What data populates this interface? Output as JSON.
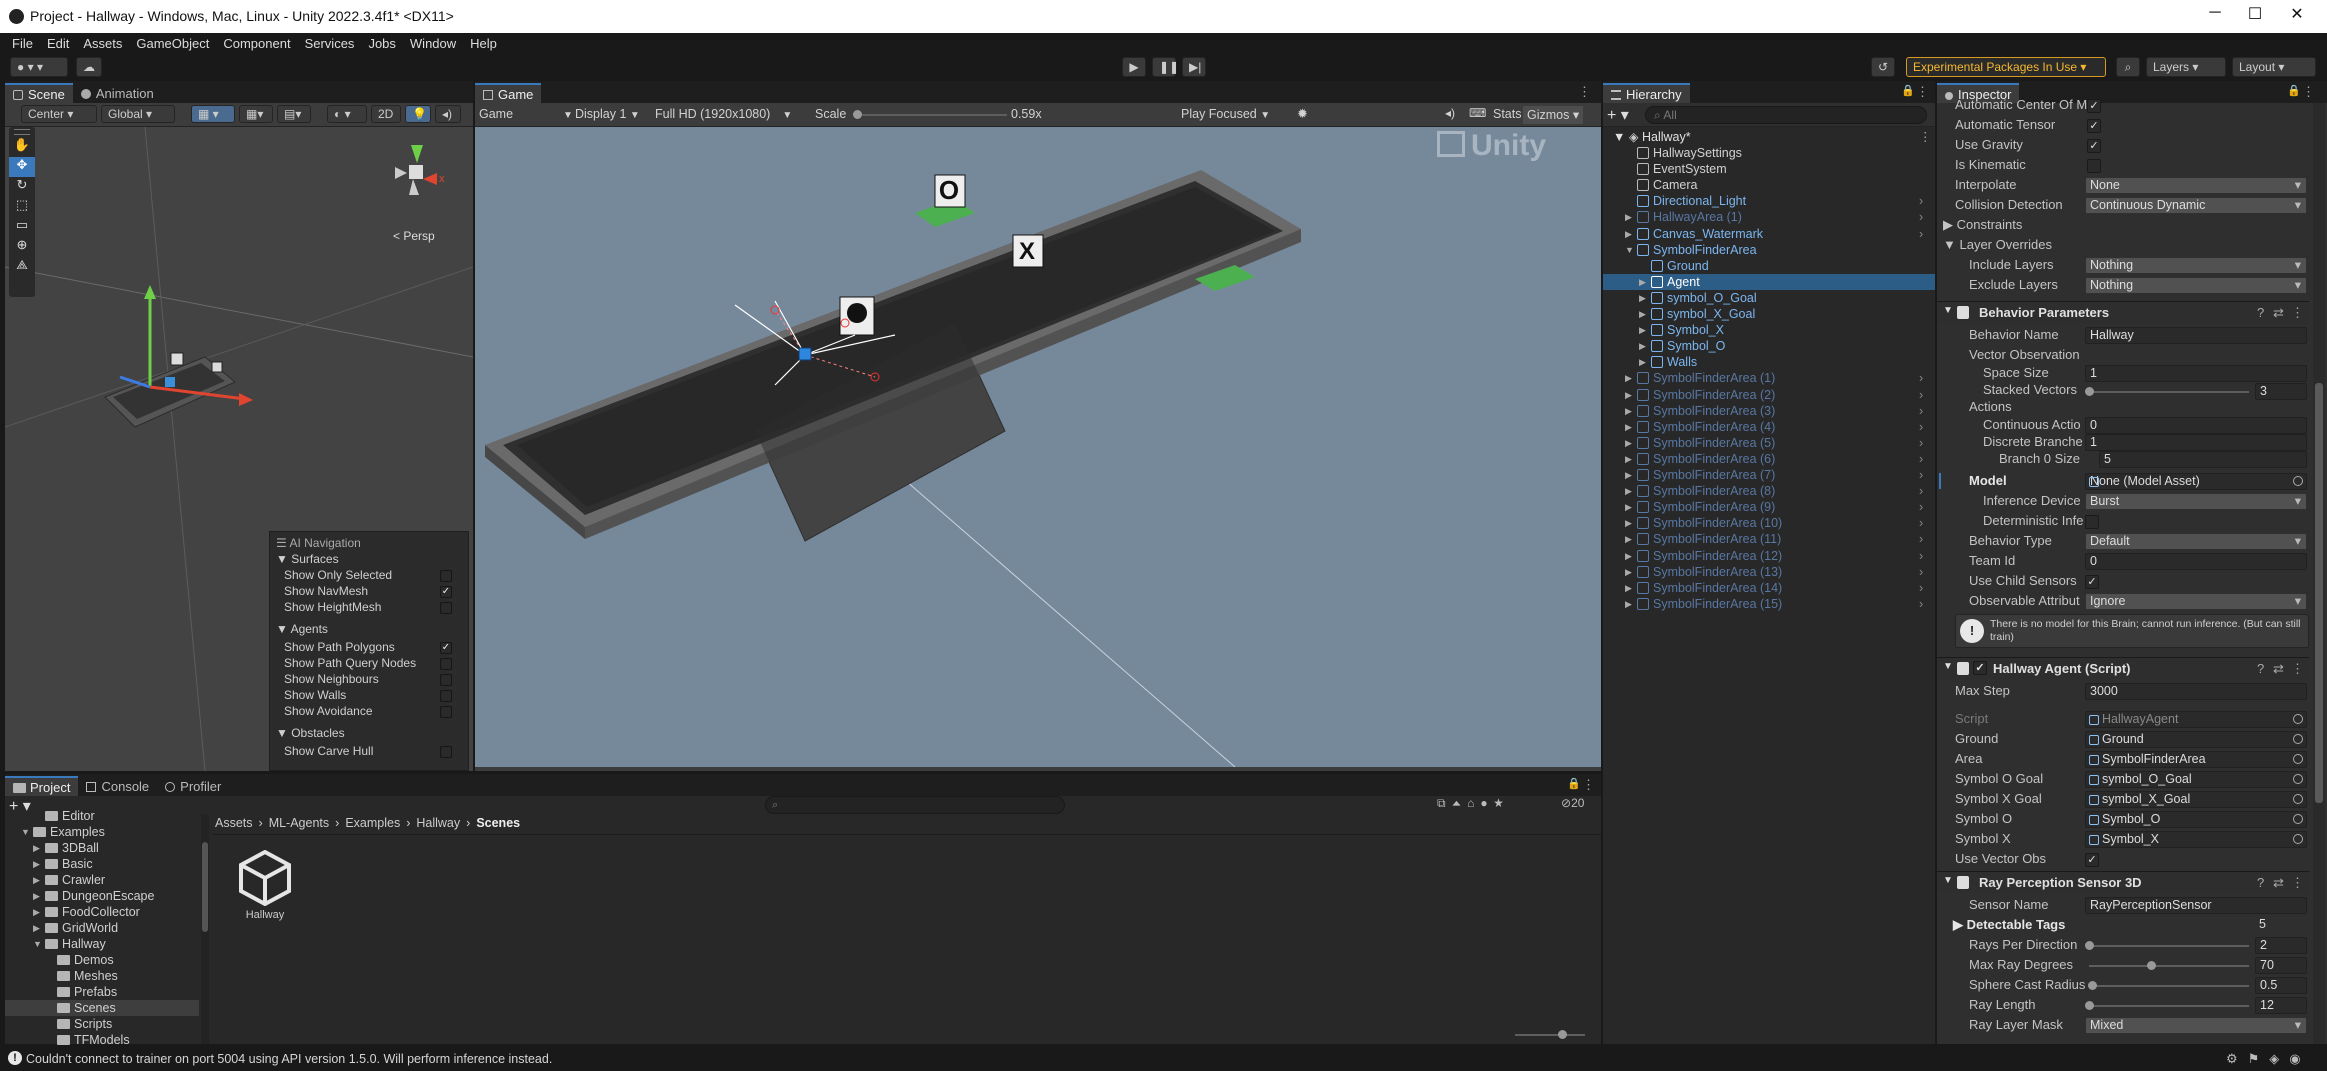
{
  "window": {
    "title": "Project - Hallway - Windows, Mac, Linux - Unity 2022.3.4f1* <DX11>",
    "minimize": "─",
    "maximize": "☐",
    "close": "✕"
  },
  "menu": [
    "File",
    "Edit",
    "Assets",
    "GameObject",
    "Component",
    "Services",
    "Jobs",
    "Window",
    "Help"
  ],
  "toolbar": {
    "experimental": "Experimental Packages In Use",
    "layers": "Layers",
    "layout": "Layout"
  },
  "scene": {
    "tabs": [
      "Scene",
      "Animation"
    ],
    "center": "Center",
    "global": "Global",
    "mode2d": "2D",
    "persp": "< Persp",
    "axis_x": "x"
  },
  "ai_nav": {
    "title": "AI Navigation",
    "surfaces": "Surfaces",
    "surface_rows": [
      {
        "label": "Show Only Selected",
        "checked": ""
      },
      {
        "label": "Show NavMesh",
        "checked": "✓"
      },
      {
        "label": "Show HeightMesh",
        "checked": ""
      }
    ],
    "agents": "Agents",
    "agent_rows": [
      {
        "label": "Show Path Polygons",
        "checked": "✓"
      },
      {
        "label": "Show Path Query Nodes",
        "checked": ""
      },
      {
        "label": "Show Neighbours",
        "checked": ""
      },
      {
        "label": "Show Walls",
        "checked": ""
      },
      {
        "label": "Show Avoidance",
        "checked": ""
      }
    ],
    "obstacles": "Obstacles",
    "obstacle_rows": [
      {
        "label": "Show Carve Hull",
        "checked": ""
      }
    ]
  },
  "game": {
    "tab": "Game",
    "display_mode": "Game",
    "display": "Display 1",
    "resolution": "Full HD (1920x1080)",
    "scale_label": "Scale",
    "scale_value": "0.59x",
    "scale_fraction": 0.59,
    "play_focused": "Play Focused",
    "stats": "Stats",
    "gizmos": "Gizmos",
    "watermark": "Unity",
    "sign_o": "O",
    "sign_x": "X"
  },
  "hierarchy": {
    "title": "Hierarchy",
    "search_placeholder": "All",
    "scene": "Hallway*",
    "items": [
      {
        "label": "HallwaySettings",
        "indent": 1,
        "color": "#d2d2d2",
        "arrow": ""
      },
      {
        "label": "EventSystem",
        "indent": 1,
        "color": "#d2d2d2",
        "arrow": ""
      },
      {
        "label": "Camera",
        "indent": 1,
        "color": "#d2d2d2",
        "arrow": ""
      },
      {
        "label": "Directional_Light",
        "indent": 1,
        "color": "#7cb6f0",
        "arrow": ""
      },
      {
        "label": "HallwayArea (1)",
        "indent": 1,
        "color": "#5877a2",
        "arrow": "▶"
      },
      {
        "label": "Canvas_Watermark",
        "indent": 1,
        "color": "#7cb6f0",
        "arrow": "▶"
      },
      {
        "label": "SymbolFinderArea",
        "indent": 1,
        "color": "#7cb6f0",
        "arrow": "▼"
      },
      {
        "label": "Ground",
        "indent": 2,
        "color": "#7cb6f0",
        "arrow": ""
      },
      {
        "label": "Agent",
        "indent": 2,
        "color": "#ffffff",
        "arrow": "▶",
        "selected": true
      },
      {
        "label": "symbol_O_Goal",
        "indent": 2,
        "color": "#7cb6f0",
        "arrow": "▶"
      },
      {
        "label": "symbol_X_Goal",
        "indent": 2,
        "color": "#7cb6f0",
        "arrow": "▶"
      },
      {
        "label": "Symbol_X",
        "indent": 2,
        "color": "#7cb6f0",
        "arrow": "▶"
      },
      {
        "label": "Symbol_O",
        "indent": 2,
        "color": "#7cb6f0",
        "arrow": "▶"
      },
      {
        "label": "Walls",
        "indent": 2,
        "color": "#7cb6f0",
        "arrow": "▶"
      },
      {
        "label": "SymbolFinderArea (1)",
        "indent": 1,
        "color": "#5877a2",
        "arrow": "▶"
      },
      {
        "label": "SymbolFinderArea (2)",
        "indent": 1,
        "color": "#5877a2",
        "arrow": "▶"
      },
      {
        "label": "SymbolFinderArea (3)",
        "indent": 1,
        "color": "#5877a2",
        "arrow": "▶"
      },
      {
        "label": "SymbolFinderArea (4)",
        "indent": 1,
        "color": "#5877a2",
        "arrow": "▶"
      },
      {
        "label": "SymbolFinderArea (5)",
        "indent": 1,
        "color": "#5877a2",
        "arrow": "▶"
      },
      {
        "label": "SymbolFinderArea (6)",
        "indent": 1,
        "color": "#5877a2",
        "arrow": "▶"
      },
      {
        "label": "SymbolFinderArea (7)",
        "indent": 1,
        "color": "#5877a2",
        "arrow": "▶"
      },
      {
        "label": "SymbolFinderArea (8)",
        "indent": 1,
        "color": "#5877a2",
        "arrow": "▶"
      },
      {
        "label": "SymbolFinderArea (9)",
        "indent": 1,
        "color": "#5877a2",
        "arrow": "▶"
      },
      {
        "label": "SymbolFinderArea (10)",
        "indent": 1,
        "color": "#5877a2",
        "arrow": "▶"
      },
      {
        "label": "SymbolFinderArea (11)",
        "indent": 1,
        "color": "#5877a2",
        "arrow": "▶"
      },
      {
        "label": "SymbolFinderArea (12)",
        "indent": 1,
        "color": "#5877a2",
        "arrow": "▶"
      },
      {
        "label": "SymbolFinderArea (13)",
        "indent": 1,
        "color": "#5877a2",
        "arrow": "▶"
      },
      {
        "label": "SymbolFinderArea (14)",
        "indent": 1,
        "color": "#5877a2",
        "arrow": "▶"
      },
      {
        "label": "SymbolFinderArea (15)",
        "indent": 1,
        "color": "#5877a2",
        "arrow": "▶"
      }
    ]
  },
  "inspector": {
    "title": "Inspector",
    "rigidbody": {
      "auto_center": "Automatic Center Of M",
      "auto_tensor": "Automatic Tensor",
      "use_gravity": "Use Gravity",
      "is_kinematic": "Is Kinematic",
      "interpolate": "Interpolate",
      "interpolate_val": "None",
      "collision": "Collision Detection",
      "collision_val": "Continuous Dynamic",
      "constraints": "Constraints",
      "layer_overrides": "Layer Overrides",
      "include_layers": "Include Layers",
      "include_val": "Nothing",
      "exclude_layers": "Exclude Layers",
      "exclude_val": "Nothing"
    },
    "behavior": {
      "title": "Behavior Parameters",
      "name_label": "Behavior Name",
      "name_val": "Hallway",
      "vector_obs": "Vector Observation",
      "space_size": "Space Size",
      "space_size_val": "1",
      "stacked": "Stacked Vectors",
      "stacked_val": "3",
      "stacked_fraction": 0.0,
      "actions": "Actions",
      "continuous": "Continuous Actio",
      "continuous_val": "0",
      "discrete": "Discrete Branche",
      "discrete_val": "1",
      "branch0": "Branch 0 Size",
      "branch0_val": "5",
      "model": "Model",
      "model_val": "None (Model Asset)",
      "inference": "Inference Device",
      "inference_val": "Burst",
      "deterministic": "Deterministic Infe",
      "btype": "Behavior Type",
      "btype_val": "Default",
      "team": "Team Id",
      "team_val": "0",
      "child_sensors": "Use Child Sensors",
      "observable": "Observable Attribut",
      "observable_val": "Ignore",
      "warning": "There is no model for this Brain; cannot run inference. (But can still train)"
    },
    "agent": {
      "title": "Hallway Agent (Script)",
      "max_step": "Max Step",
      "max_step_val": "3000",
      "script": "Script",
      "script_val": "HallwayAgent",
      "ground": "Ground",
      "ground_val": "Ground",
      "area": "Area",
      "area_val": "SymbolFinderArea",
      "o_goal": "Symbol O Goal",
      "o_goal_val": "symbol_O_Goal",
      "x_goal": "Symbol X Goal",
      "x_goal_val": "symbol_X_Goal",
      "sym_o": "Symbol O",
      "sym_o_val": "Symbol_O",
      "sym_x": "Symbol X",
      "sym_x_val": "Symbol_X",
      "vector_obs": "Use Vector Obs"
    },
    "ray": {
      "title": "Ray Perception Sensor 3D",
      "sensor_name": "Sensor Name",
      "sensor_name_val": "RayPerceptionSensor",
      "tags": "Detectable Tags",
      "tags_val": "5",
      "rays": "Rays Per Direction",
      "rays_val": "2",
      "rays_fraction": 0.0,
      "degrees": "Max Ray Degrees",
      "degrees_val": "70",
      "degrees_fraction": 0.39,
      "sphere": "Sphere Cast Radius",
      "sphere_val": "0.5",
      "sphere_fraction": 0.02,
      "length": "Ray Length",
      "length_val": "12",
      "length_fraction": 0.0,
      "mask": "Ray Layer Mask",
      "mask_val": "Mixed"
    }
  },
  "project": {
    "tabs": [
      "Project",
      "Console",
      "Profiler"
    ],
    "tree": [
      {
        "label": "Editor",
        "indent": 2,
        "arrow": ""
      },
      {
        "label": "Examples",
        "indent": 1,
        "arrow": "▼"
      },
      {
        "label": "3DBall",
        "indent": 2,
        "arrow": "▶"
      },
      {
        "label": "Basic",
        "indent": 2,
        "arrow": "▶"
      },
      {
        "label": "Crawler",
        "indent": 2,
        "arrow": "▶"
      },
      {
        "label": "DungeonEscape",
        "indent": 2,
        "arrow": "▶"
      },
      {
        "label": "FoodCollector",
        "indent": 2,
        "arrow": "▶"
      },
      {
        "label": "GridWorld",
        "indent": 2,
        "arrow": "▶"
      },
      {
        "label": "Hallway",
        "indent": 2,
        "arrow": "▼"
      },
      {
        "label": "Demos",
        "indent": 3,
        "arrow": ""
      },
      {
        "label": "Meshes",
        "indent": 3,
        "arrow": ""
      },
      {
        "label": "Prefabs",
        "indent": 3,
        "arrow": ""
      },
      {
        "label": "Scenes",
        "indent": 3,
        "arrow": "",
        "selected": true
      },
      {
        "label": "Scripts",
        "indent": 3,
        "arrow": ""
      },
      {
        "label": "TFModels",
        "indent": 3,
        "arrow": ""
      }
    ],
    "breadcrumb": [
      "Assets",
      "ML-Agents",
      "Examples",
      "Hallway",
      "Scenes"
    ],
    "asset": "Hallway",
    "count": "20"
  },
  "status": {
    "message": "Couldn't connect to trainer on port 5004 using API version 1.5.0. Will perform inference instead."
  }
}
